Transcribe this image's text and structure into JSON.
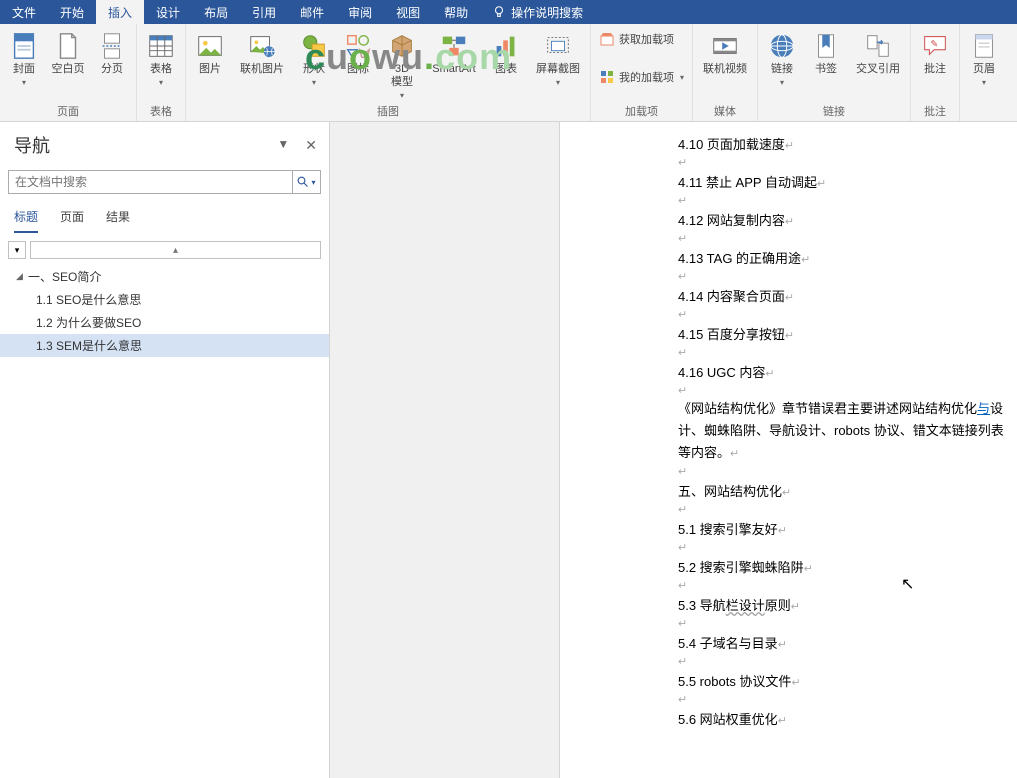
{
  "tabs": [
    "文件",
    "开始",
    "插入",
    "设计",
    "布局",
    "引用",
    "邮件",
    "审阅",
    "视图",
    "帮助"
  ],
  "active_tab_index": 2,
  "tell_me": "操作说明搜索",
  "ribbon": {
    "pages": {
      "label": "页面",
      "cover": "封面",
      "blank": "空白页",
      "break": "分页"
    },
    "tables": {
      "label": "表格",
      "table": "表格"
    },
    "illus": {
      "label": "插图",
      "pic": "图片",
      "online": "联机图片",
      "shapes": "形状",
      "icons": "图标",
      "model": "3D\n模型",
      "smartart": "SmartArt",
      "chart": "图表",
      "screenshot": "屏幕截图"
    },
    "addins": {
      "label": "加载项",
      "get": "获取加载项",
      "my": "我的加载项"
    },
    "media": {
      "label": "媒体",
      "video": "联机视频"
    },
    "links": {
      "label": "链接",
      "link": "链接",
      "bookmark": "书签",
      "crossref": "交叉引用"
    },
    "comments": {
      "label": "批注",
      "comment": "批注"
    },
    "header": {
      "hdr": "页眉"
    }
  },
  "nav": {
    "title": "导航",
    "search_placeholder": "在文档中搜索",
    "tabs": [
      "标题",
      "页面",
      "结果"
    ],
    "tree": [
      {
        "text": "一、SEO简介",
        "level": 0,
        "caret": true
      },
      {
        "text": "1.1 SEO是什么意思",
        "level": 1
      },
      {
        "text": "1.2 为什么要做SEO",
        "level": 1
      },
      {
        "text": "1.3 SEM是什么意思",
        "level": 1,
        "selected": true
      }
    ]
  },
  "doc": {
    "lines": [
      "4.10 页面加载速度",
      "4.11 禁止 APP 自动调起",
      "4.12 网站复制内容",
      "4.13 TAG 的正确用途",
      "4.14 内容聚合页面",
      "4.15 百度分享按钮",
      "4.16 UGC 内容"
    ],
    "para_pre": "《网站结构优化》章节错误君主要讲述网站结构优化",
    "para_link": "与",
    "para_post": "设计、蜘蛛陷阱、导航设计、robots 协议、错文本链接列表等内容。",
    "heading5": "五、网站结构优化",
    "lines2": [
      "5.1 搜索引擎友好",
      "5.2 搜索引擎蜘蛛陷阱"
    ],
    "line53_a": "5.3 导航",
    "line53_b": "栏设计",
    "line53_c": "原则",
    "lines3": [
      "5.4 子域名与目录",
      "5.5 robots 协议文件",
      "5.6 网站权重优化"
    ]
  },
  "watermark": "cuowu.com"
}
